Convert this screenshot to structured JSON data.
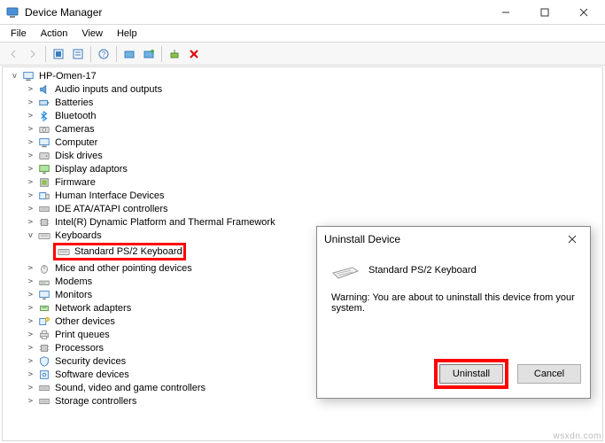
{
  "window": {
    "title": "Device Manager"
  },
  "menu": {
    "file": "File",
    "action": "Action",
    "view": "View",
    "help": "Help"
  },
  "tree": {
    "root": "HP-Omen-17",
    "items": [
      {
        "label": "Audio inputs and outputs",
        "expander": ">"
      },
      {
        "label": "Batteries",
        "expander": ">"
      },
      {
        "label": "Bluetooth",
        "expander": ">"
      },
      {
        "label": "Cameras",
        "expander": ">"
      },
      {
        "label": "Computer",
        "expander": ">"
      },
      {
        "label": "Disk drives",
        "expander": ">"
      },
      {
        "label": "Display adaptors",
        "expander": ">"
      },
      {
        "label": "Firmware",
        "expander": ">"
      },
      {
        "label": "Human Interface Devices",
        "expander": ">"
      },
      {
        "label": "IDE ATA/ATAPI controllers",
        "expander": ">"
      },
      {
        "label": "Intel(R) Dynamic Platform and Thermal Framework",
        "expander": ">"
      }
    ],
    "keyboards": {
      "label": "Keyboards",
      "expander": "v",
      "child": "Standard PS/2 Keyboard"
    },
    "rest": [
      {
        "label": "Mice and other pointing devices",
        "expander": ">"
      },
      {
        "label": "Modems",
        "expander": ">"
      },
      {
        "label": "Monitors",
        "expander": ">"
      },
      {
        "label": "Network adapters",
        "expander": ">"
      },
      {
        "label": "Other devices",
        "expander": ">"
      },
      {
        "label": "Print queues",
        "expander": ">"
      },
      {
        "label": "Processors",
        "expander": ">"
      },
      {
        "label": "Security devices",
        "expander": ">"
      },
      {
        "label": "Software devices",
        "expander": ">"
      },
      {
        "label": "Sound, video and game controllers",
        "expander": ">"
      },
      {
        "label": "Storage controllers",
        "expander": ">"
      }
    ]
  },
  "dialog": {
    "title": "Uninstall Device",
    "device": "Standard PS/2 Keyboard",
    "warning": "Warning: You are about to uninstall this device from your system.",
    "uninstall": "Uninstall",
    "cancel": "Cancel"
  },
  "watermark": "wsxdn.com"
}
